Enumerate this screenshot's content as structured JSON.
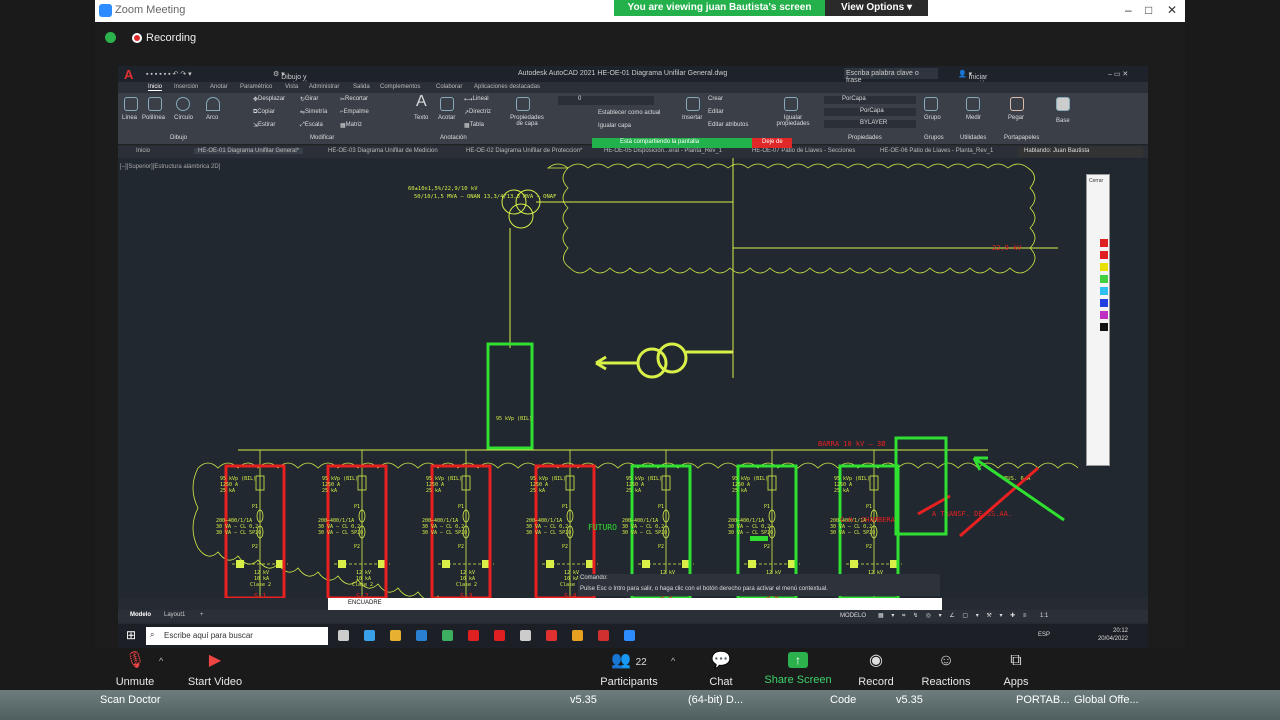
{
  "zoom": {
    "window_title": "Zoom Meeting",
    "viewing_banner": "You are viewing juan Bautista's screen",
    "view_options": "View Options",
    "recording_label": "Recording",
    "toolbar": {
      "unmute": "Unmute",
      "start_video": "Start Video",
      "participants": "Participants",
      "participants_count": "22",
      "chat": "Chat",
      "share_screen": "Share Screen",
      "record": "Record",
      "reactions": "Reactions",
      "apps": "Apps"
    }
  },
  "autocad": {
    "app_title": "Autodesk AutoCAD 2021   HE-OE-01 Diagrama Unifilar General.dwg",
    "workspace": "Dibujo y anotación",
    "search_placeholder": "Escriba palabra clave o frase",
    "login": "Iniciar sesión",
    "menu_tabs": [
      "Inicio",
      "Inserción",
      "Anotar",
      "Paramétrico",
      "Vista",
      "Administrar",
      "Salida",
      "Complementos",
      "Colaborar",
      "Aplicaciones destacadas"
    ],
    "ribbon": {
      "linea": "Línea",
      "polilinea": "Polilínea",
      "circulo": "Círculo",
      "arco": "Arco",
      "dibujo_panel": "Dibujo",
      "desplazar": "Desplazar",
      "girar": "Girar",
      "recortar": "Recortar",
      "copiar": "Copiar",
      "simetria": "Simetría",
      "empalme": "Empalme",
      "estirar": "Estirar",
      "escala": "Escala",
      "matriz": "Matriz",
      "modificar_panel": "Modificar",
      "texto": "Texto",
      "acotar": "Acotar",
      "lineal": "Lineal",
      "directriz": "Directriz",
      "tabla": "Tabla",
      "anotacion_panel": "Anotación",
      "propiedades_capa": "Propiedades de capa",
      "establecer_actual": "Establecer como actual",
      "igualar_capa": "Igualar capa",
      "insertar": "Insertar",
      "crear": "Crear",
      "editar": "Editar",
      "editar_atributos": "Editar atributos",
      "igualar_propiedades": "Igualar propiedades",
      "porcapa1": "PorCapa",
      "porcapa2": "PorCapa",
      "bylayer": "BYLAYER",
      "propiedades_panel": "Propiedades",
      "grupo": "Grupo",
      "grupos_panel": "Grupos",
      "medir": "Medir",
      "utilidades_panel": "Utilidades",
      "pegar": "Pegar",
      "portapapeles_panel": "Portapapeles",
      "base": "Base",
      "layer_value": "0"
    },
    "doc_tabs": [
      "Inicio",
      "HE-OE-01 Diagrama Unifilar General*",
      "HE-OE-03 Diagrama Unifilar de Medicion",
      "HE-OE-02 Diagrama Unifilar de Proteccion*",
      "HE-OE-05 Disposición...eral - Planta_Rev_1",
      "HE-OE-07 Patio de Llaves - Secciones",
      "HE-OE-06 Patio de Llaves - Planta_Rev_1"
    ],
    "sharing_banner": "Está compartiendo la pantalla",
    "stop_share": "Deje de",
    "talking": "Hablando: Juan Bautista",
    "viewport_label": "[–][Superior][Estructura alámbrica 2D]",
    "palette_close": "Cerrar",
    "command_label": "Comando:",
    "command_history": "Pulse Esc o Intro para salir, o haga clic con el botón derecho para activar el menú contextual.",
    "command_input": "ENCUADRE",
    "model_tabs": [
      "Modelo",
      "Layout1",
      "+"
    ],
    "status_model": "MODELO",
    "status_scale": "1:1",
    "taskbar_search": "Escribe aquí para buscar",
    "tray_lang": "ESP",
    "clock_time": "20:12",
    "clock_date": "20/04/2022"
  },
  "drawing": {
    "transformer_rating": "50/10/1,5 MVA – ONAN\n13,3/4/13,3 MVA – ONAF",
    "transformer_kv": "60±10x1,5%/22,9/10 kV",
    "busbar_label": "BARRA 10 kV – 3Ø",
    "feeder_labels": [
      "S-1",
      "S-2",
      "S-3",
      "S-4",
      "S-5",
      "S-6"
    ],
    "futuro": "FUTURO",
    "chambera": "C.H. CHAMBERA",
    "transf_label": "A TRANSF. DE SS.AA.",
    "kv_229": "22,9 kV",
    "fusible": "FUS. 6 A",
    "device_12kv": "12 kV",
    "device_10ka": "10 kA",
    "device_clase": "Clase 2",
    "ct_ratio": "200–400/1/1A",
    "ct_cl1": "30 VA – CL 0,2",
    "ct_cl2": "30 VA – CL 5P20",
    "breaker_bil": "95 kVp (BIL)",
    "breaker_a": "1250 A",
    "breaker_ka": "25 kA",
    "p1": "P1",
    "p2": "P2"
  },
  "desktop": {
    "items": [
      "Scan Doctor",
      "v5.35",
      "(64-bit) D...",
      "Code",
      "v5.35",
      "PORTAB...",
      "Global Offe..."
    ]
  },
  "colors": {
    "cad_line": "#d8f048",
    "cad_red": "#e82020",
    "cad_green": "#30e030",
    "zoom_green": "#24b14b"
  }
}
